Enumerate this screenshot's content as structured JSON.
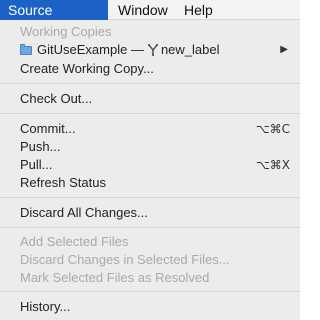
{
  "menubar": {
    "items": [
      {
        "label": "Source Control",
        "active": true
      },
      {
        "label": "Window",
        "active": false
      },
      {
        "label": "Help",
        "active": false
      }
    ]
  },
  "menu": {
    "working_copies_header": "Working Copies",
    "repo": {
      "name": "GitUseExample",
      "separator": "—",
      "branch": "new_label",
      "icon": "folder-icon",
      "branch_icon": "branch-icon",
      "submenu_indicator": "▶"
    },
    "create_working_copy": "Create Working Copy...",
    "check_out": "Check Out...",
    "commit": {
      "label": "Commit...",
      "shortcut": "⌥⌘C"
    },
    "push": {
      "label": "Push..."
    },
    "pull": {
      "label": "Pull...",
      "shortcut": "⌥⌘X"
    },
    "refresh_status": "Refresh Status",
    "discard_all": "Discard All Changes...",
    "add_selected": "Add Selected Files",
    "discard_selected": "Discard Changes in Selected Files...",
    "mark_resolved": "Mark Selected Files as Resolved",
    "history": "History..."
  },
  "colors": {
    "active_menu_bg": "#1c62c6",
    "menu_bg": "#ececec",
    "disabled_text": "#a9a9a9"
  }
}
